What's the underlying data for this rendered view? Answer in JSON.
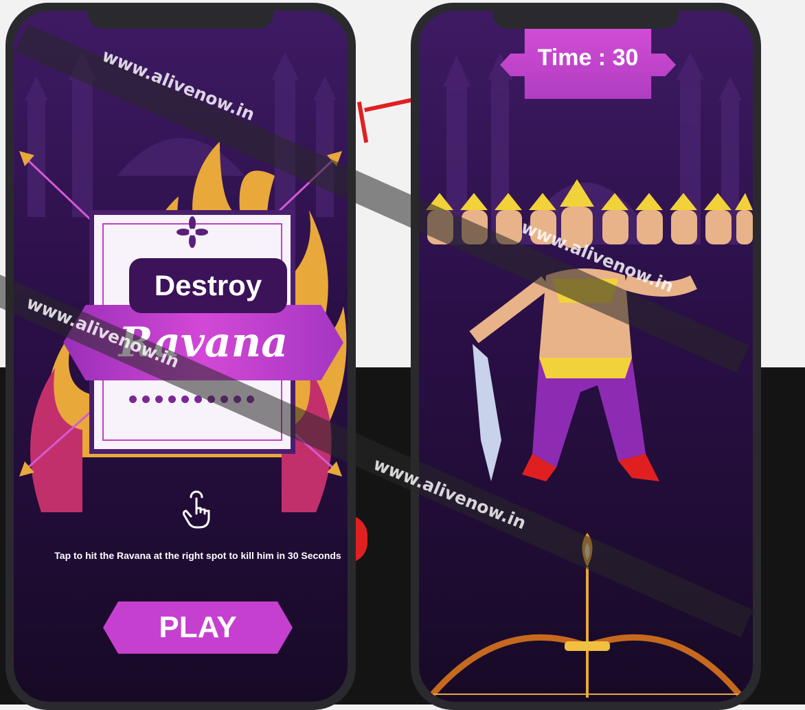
{
  "left_screen": {
    "title_top": "Destroy",
    "title_main": "Ravana",
    "instructions": "Tap to hit the Ravana at the right spot to kill him in 30 Seconds",
    "play_label": "PLAY",
    "tap_icon": "hand-tap-icon"
  },
  "right_screen": {
    "timer": "Time : 30"
  },
  "watermarks": [
    "www.alivenow.in",
    "www.alivenow.in",
    "www.alivenow.in",
    "www.alivenow.in"
  ],
  "colors": {
    "screen_top": "#3e1a63",
    "screen_bottom": "#170a26",
    "accent_pink": "#c640d0",
    "card_frame": "#4a1e6e",
    "ravana_yellow": "#f2d23a",
    "ravana_purple": "#8e2bb3"
  }
}
